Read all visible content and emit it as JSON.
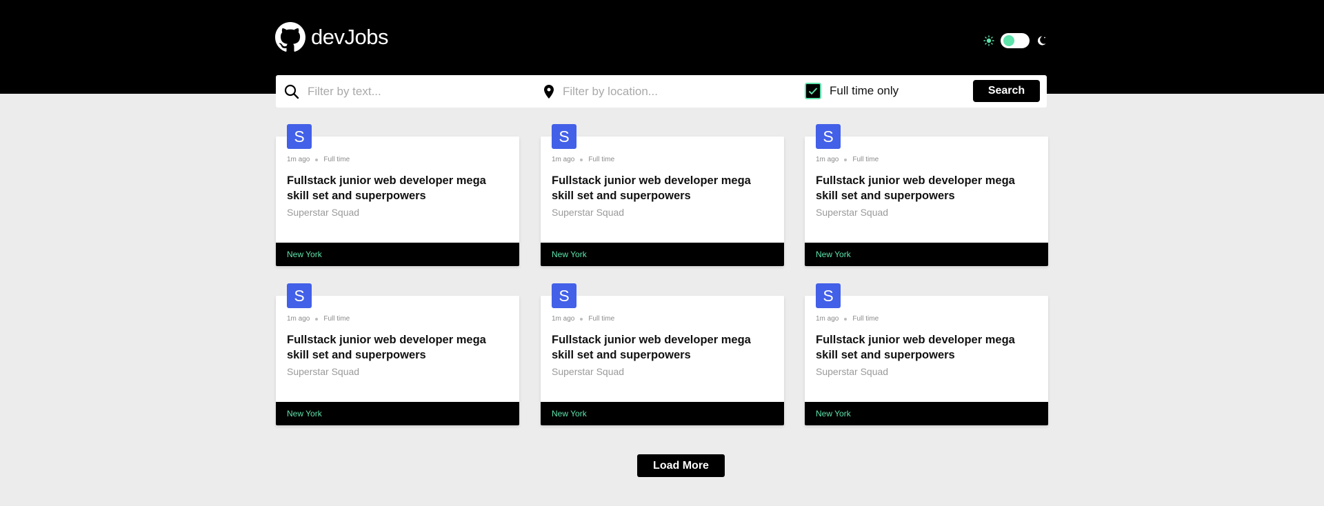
{
  "header": {
    "logo_text": "devJobs",
    "logo_icon": "github-icon",
    "theme_icons": [
      "sun-icon",
      "moon-icon"
    ]
  },
  "search": {
    "text_placeholder": "Filter by text...",
    "text_value": "",
    "location_placeholder": "Filter by location...",
    "location_value": "",
    "fulltime_label": "Full time only",
    "fulltime_checked": true,
    "button_label": "Search"
  },
  "jobs": [
    {
      "badge": "S",
      "posted": "1m ago",
      "type": "Full time",
      "title": "Fullstack junior web developer mega skill set and superpowers",
      "company": "Superstar Squad",
      "location": "New York"
    },
    {
      "badge": "S",
      "posted": "1m ago",
      "type": "Full time",
      "title": "Fullstack junior web developer mega skill set and superpowers",
      "company": "Superstar Squad",
      "location": "New York"
    },
    {
      "badge": "S",
      "posted": "1m ago",
      "type": "Full time",
      "title": "Fullstack junior web developer mega skill set and superpowers",
      "company": "Superstar Squad",
      "location": "New York"
    },
    {
      "badge": "S",
      "posted": "1m ago",
      "type": "Full time",
      "title": "Fullstack junior web developer mega skill set and superpowers",
      "company": "Superstar Squad",
      "location": "New York"
    },
    {
      "badge": "S",
      "posted": "1m ago",
      "type": "Full time",
      "title": "Fullstack junior web developer mega skill set and superpowers",
      "company": "Superstar Squad",
      "location": "New York"
    },
    {
      "badge": "S",
      "posted": "1m ago",
      "type": "Full time",
      "title": "Fullstack junior web developer mega skill set and superpowers",
      "company": "Superstar Squad",
      "location": "New York"
    }
  ],
  "load_more_label": "Load More",
  "colors": {
    "accent": "#5ee3ab",
    "badge": "#4360e8",
    "header_bg": "#000000",
    "page_bg": "#ececec"
  }
}
